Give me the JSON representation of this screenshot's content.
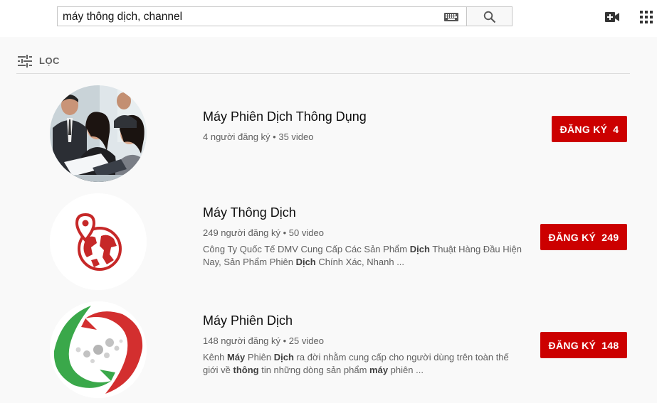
{
  "header": {
    "search": {
      "value": "máy thông dịch, channel",
      "placeholder": "Tìm kiếm"
    },
    "icons": [
      "keyboard-icon",
      "search-icon",
      "video-upload-icon",
      "apps-grid-icon"
    ],
    "accent_color": "#cc0000"
  },
  "filter": {
    "label": "LỌC",
    "icon": "filter-sliders-icon"
  },
  "results": [
    {
      "title": "Máy Phiên Dịch Thông Dụng",
      "meta": "4 người đăng ký • 35 video",
      "description": [],
      "subscribe_label": "ĐĂNG KÝ",
      "subscribe_count": "4"
    },
    {
      "title": "Máy Thông Dịch",
      "meta": "249 người đăng ký • 50 video",
      "description": [
        {
          "t": "Công Ty Quốc Tế DMV Cung Cấp Các Sản Phẩm ",
          "b": false
        },
        {
          "t": "Dịch",
          "b": true
        },
        {
          "t": " Thuật Hàng Đầu Hiện Nay, Sản Phẩm Phiên ",
          "b": false
        },
        {
          "t": "Dịch",
          "b": true
        },
        {
          "t": " Chính Xác, Nhanh ...",
          "b": false
        }
      ],
      "subscribe_label": "ĐĂNG KÝ",
      "subscribe_count": "249"
    },
    {
      "title": "Máy Phiên Dịch",
      "meta": "148 người đăng ký • 25 video",
      "description": [
        {
          "t": "Kênh ",
          "b": false
        },
        {
          "t": "Máy",
          "b": true
        },
        {
          "t": " Phiên ",
          "b": false
        },
        {
          "t": "Dịch",
          "b": true
        },
        {
          "t": " ra đời nhằm cung cấp cho người dùng trên toàn thế giới về ",
          "b": false
        },
        {
          "t": "thông",
          "b": true
        },
        {
          "t": " tin những dòng sản phẩm ",
          "b": false
        },
        {
          "t": "máy",
          "b": true
        },
        {
          "t": " phiên ...",
          "b": false
        }
      ],
      "subscribe_label": "ĐĂNG KÝ",
      "subscribe_count": "148"
    }
  ]
}
